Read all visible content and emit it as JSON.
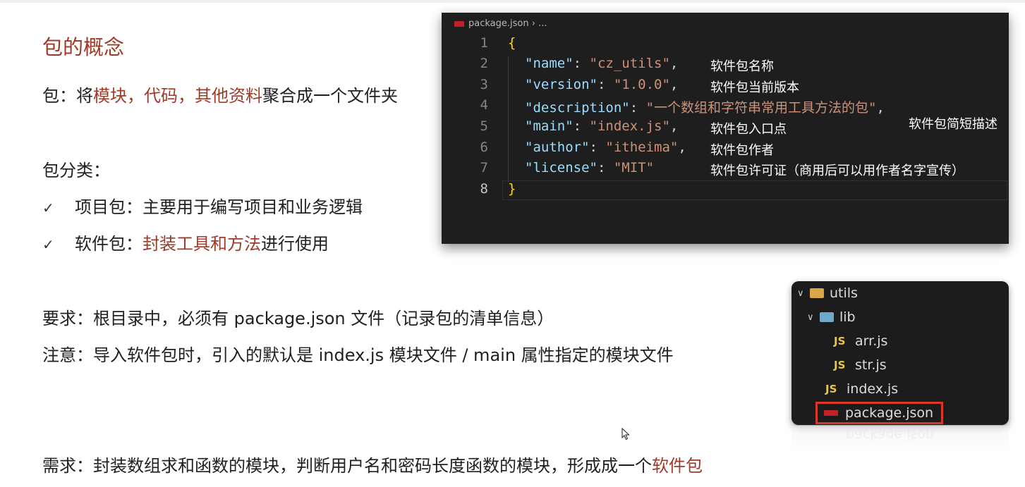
{
  "slide": {
    "title": "包的概念",
    "intro": {
      "prefix": "包：将",
      "highlight": "模块，代码，其他资料",
      "suffix": "聚合成一个文件夹"
    },
    "classify_label": "包分类：",
    "checks": [
      {
        "mark": "✓",
        "prefix": "项目包：主要用于编写项目和业务逻辑",
        "highlight": "",
        "suffix": ""
      },
      {
        "mark": "✓",
        "prefix": "软件包：",
        "highlight": "封装工具和方法",
        "suffix": "进行使用"
      }
    ],
    "requirement": "要求：根目录中，必须有 package.json 文件（记录包的清单信息）",
    "note": "注意：导入软件包时，引入的默认是 index.js 模块文件 / main 属性指定的模块文件",
    "demand": {
      "prefix": "需求：封装数组求和函数的模块，判断用户名和密码长度函数的模块，形成成一个",
      "highlight": "软件包"
    },
    "colors": {
      "accent_red": "#a03a28"
    }
  },
  "editor": {
    "breadcrumb_file": "package.json",
    "breadcrumb_rest": " › ...",
    "lines": [
      {
        "num": "1",
        "code": "{"
      },
      {
        "num": "2",
        "key": "\"name\"",
        "value": "\"cz_utils\"",
        "trail": ",",
        "comment": "软件包名称"
      },
      {
        "num": "3",
        "key": "\"version\"",
        "value": "\"1.0.0\"",
        "trail": ",",
        "comment": "软件包当前版本"
      },
      {
        "num": "4",
        "key": "\"description\"",
        "value": "\"一个数组和字符串常用工具方法的包\"",
        "trail": ",",
        "comment": ""
      },
      {
        "num": "5",
        "key": "\"main\"",
        "value": "\"index.js\"",
        "trail": ",",
        "comment": "软件包入口点"
      },
      {
        "num": "6",
        "key": "\"author\"",
        "value": "\"itheima\"",
        "trail": ",",
        "comment": "软件包作者"
      },
      {
        "num": "7",
        "key": "\"license\"",
        "value": "\"MIT\"",
        "trail": "",
        "comment": "软件包许可证（商用后可以用作者名字宣传）"
      },
      {
        "num": "8",
        "code": "}"
      }
    ],
    "description_note": "软件包简短描述"
  },
  "explorer": {
    "root": "utils",
    "lib": "lib",
    "files_in_lib": [
      "arr.js",
      "str.js"
    ],
    "index": "index.js",
    "package": "package.json",
    "js_badge": "JS"
  }
}
